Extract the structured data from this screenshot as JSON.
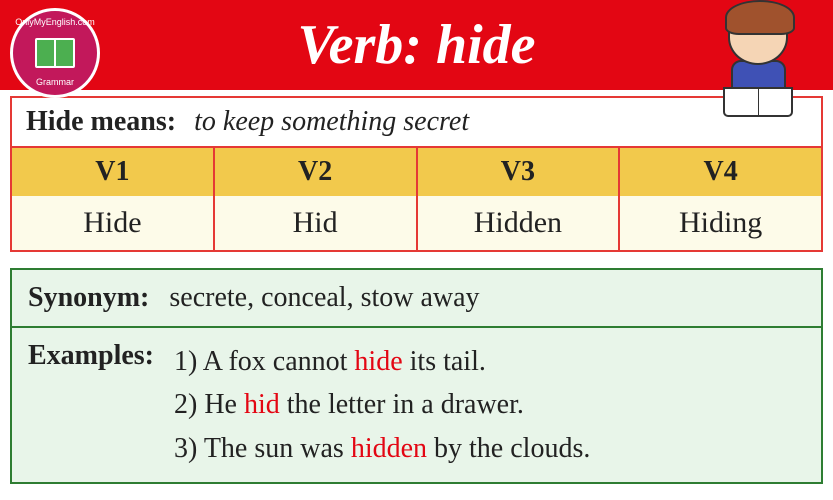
{
  "logo": {
    "top": "OnlyMyEnglish.com",
    "bottom": "Grammar"
  },
  "header": {
    "title": "Verb: hide"
  },
  "means": {
    "label": "Hide means:",
    "value": "to keep something secret"
  },
  "table": {
    "headers": [
      "V1",
      "V2",
      "V3",
      "V4"
    ],
    "values": [
      "Hide",
      "Hid",
      "Hidden",
      "Hiding"
    ]
  },
  "synonym": {
    "label": "Synonym:",
    "value": "secrete, conceal, stow away"
  },
  "examples": {
    "label": "Examples:",
    "items": [
      {
        "num": "1) ",
        "pre": "A fox cannot ",
        "hl": "hide",
        "post": " its tail."
      },
      {
        "num": "2) ",
        "pre": "He ",
        "hl": "hid",
        "post": " the letter in a drawer."
      },
      {
        "num": "3) ",
        "pre": "The sun was ",
        "hl": "hidden",
        "post": " by the clouds."
      }
    ]
  }
}
